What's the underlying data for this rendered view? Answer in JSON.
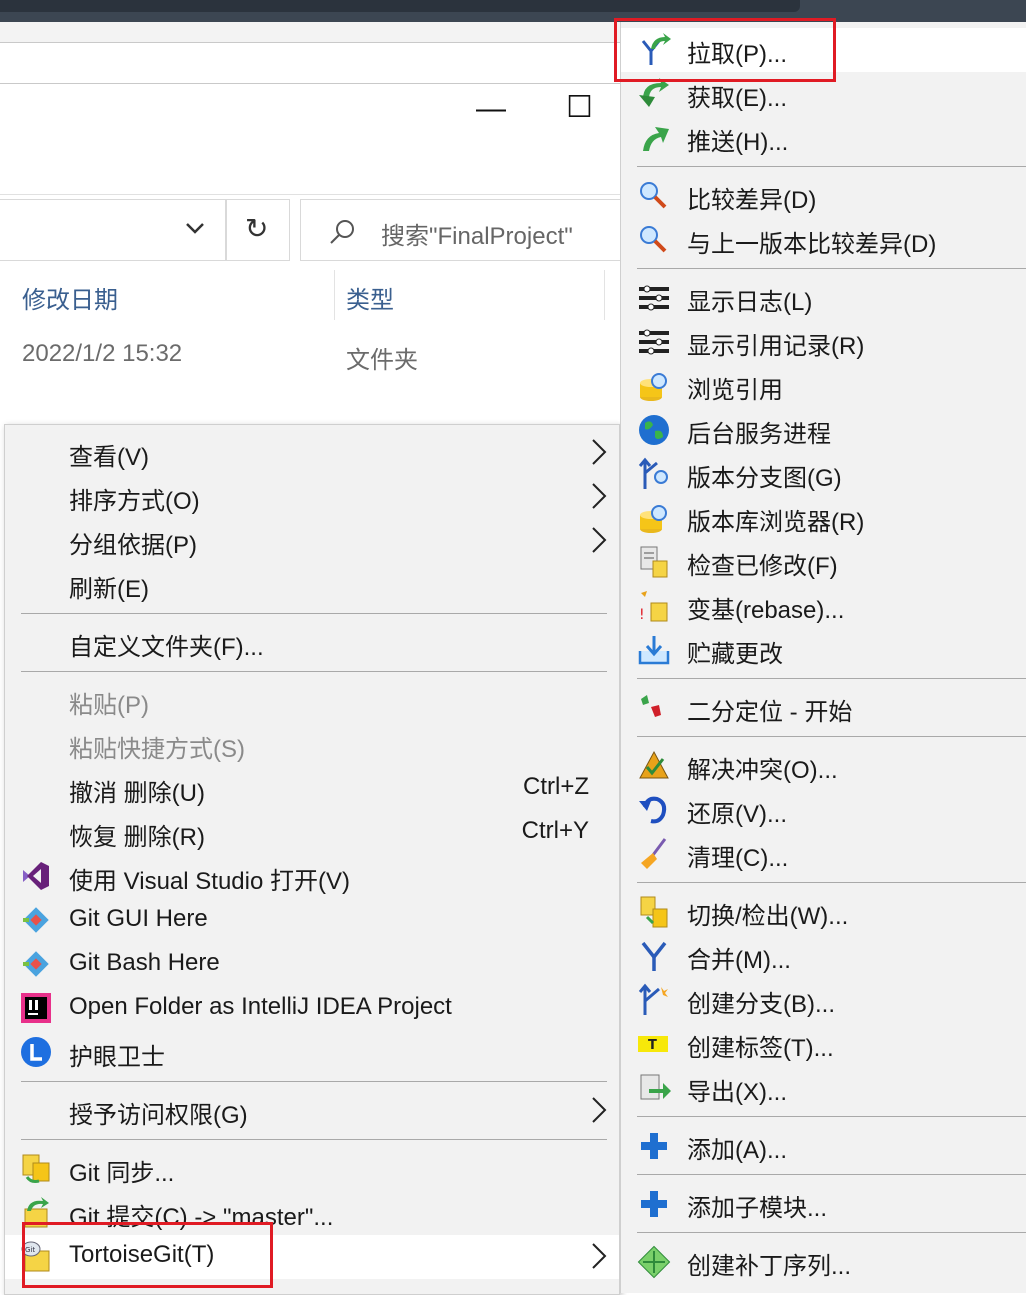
{
  "explorer": {
    "window_controls": {
      "minimize": "—",
      "maximize": "☐"
    },
    "refresh_glyph": "↻",
    "search_placeholder": "搜索\"FinalProject\"",
    "columns": [
      "修改日期",
      "类型"
    ],
    "row": {
      "modified": "2022/1/2 15:32",
      "type": "文件夹"
    }
  },
  "context_menu": {
    "view": "查看(V)",
    "sort": "排序方式(O)",
    "group": "分组依据(P)",
    "refresh": "刷新(E)",
    "customize": "自定义文件夹(F)...",
    "paste": "粘贴(P)",
    "paste_shortcut": "粘贴快捷方式(S)",
    "undo": "撤消 删除(U)",
    "undo_key": "Ctrl+Z",
    "redo": "恢复 删除(R)",
    "redo_key": "Ctrl+Y",
    "open_vs": "使用 Visual Studio 打开(V)",
    "git_gui": "Git GUI Here",
    "git_bash": "Git Bash Here",
    "intellij": "Open Folder as IntelliJ IDEA Project",
    "eye_guard": "护眼卫士",
    "grant_access": "授予访问权限(G)",
    "git_sync": "Git 同步...",
    "git_commit": "Git 提交(C) -> \"master\"...",
    "tortoise": "TortoiseGit(T)"
  },
  "tortoise_submenu": {
    "pull": "拉取(P)...",
    "fetch": "获取(E)...",
    "push": "推送(H)...",
    "diff": "比较差异(D)",
    "diff_prev": "与上一版本比较差异(D)",
    "show_log": "显示日志(L)",
    "reflog": "显示引用记录(R)",
    "browse_refs": "浏览引用",
    "daemon": "后台服务进程",
    "revision_graph": "版本分支图(G)",
    "repo_browser": "版本库浏览器(R)",
    "check_mods": "检查已修改(F)",
    "rebase": "变基(rebase)...",
    "stash": "贮藏更改",
    "bisect": "二分定位 - 开始",
    "resolve": "解决冲突(O)...",
    "revert": "还原(V)...",
    "cleanup": "清理(C)...",
    "switch": "切换/检出(W)...",
    "merge": "合并(M)...",
    "branch": "创建分支(B)...",
    "tag": "创建标签(T)...",
    "export": "导出(X)...",
    "add": "添加(A)...",
    "add_submodule": "添加子模块...",
    "patch_series": "创建补丁序列...",
    "tag_icon_text": "T"
  },
  "colors": {
    "highlight_box": "#e01b24",
    "menu_bg": "#f2f2f2"
  }
}
